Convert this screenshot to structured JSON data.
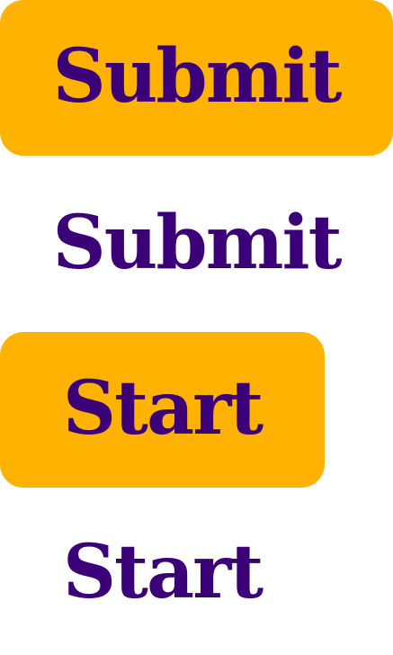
{
  "colors": {
    "accent": "#FFB300",
    "text": "#3B0077",
    "background": "#FFFFFF"
  },
  "buttons": {
    "submit_filled": {
      "label": "Submit"
    },
    "submit_text": {
      "label": "Submit"
    },
    "start_filled": {
      "label": "Start"
    },
    "start_text": {
      "label": "Start"
    }
  }
}
